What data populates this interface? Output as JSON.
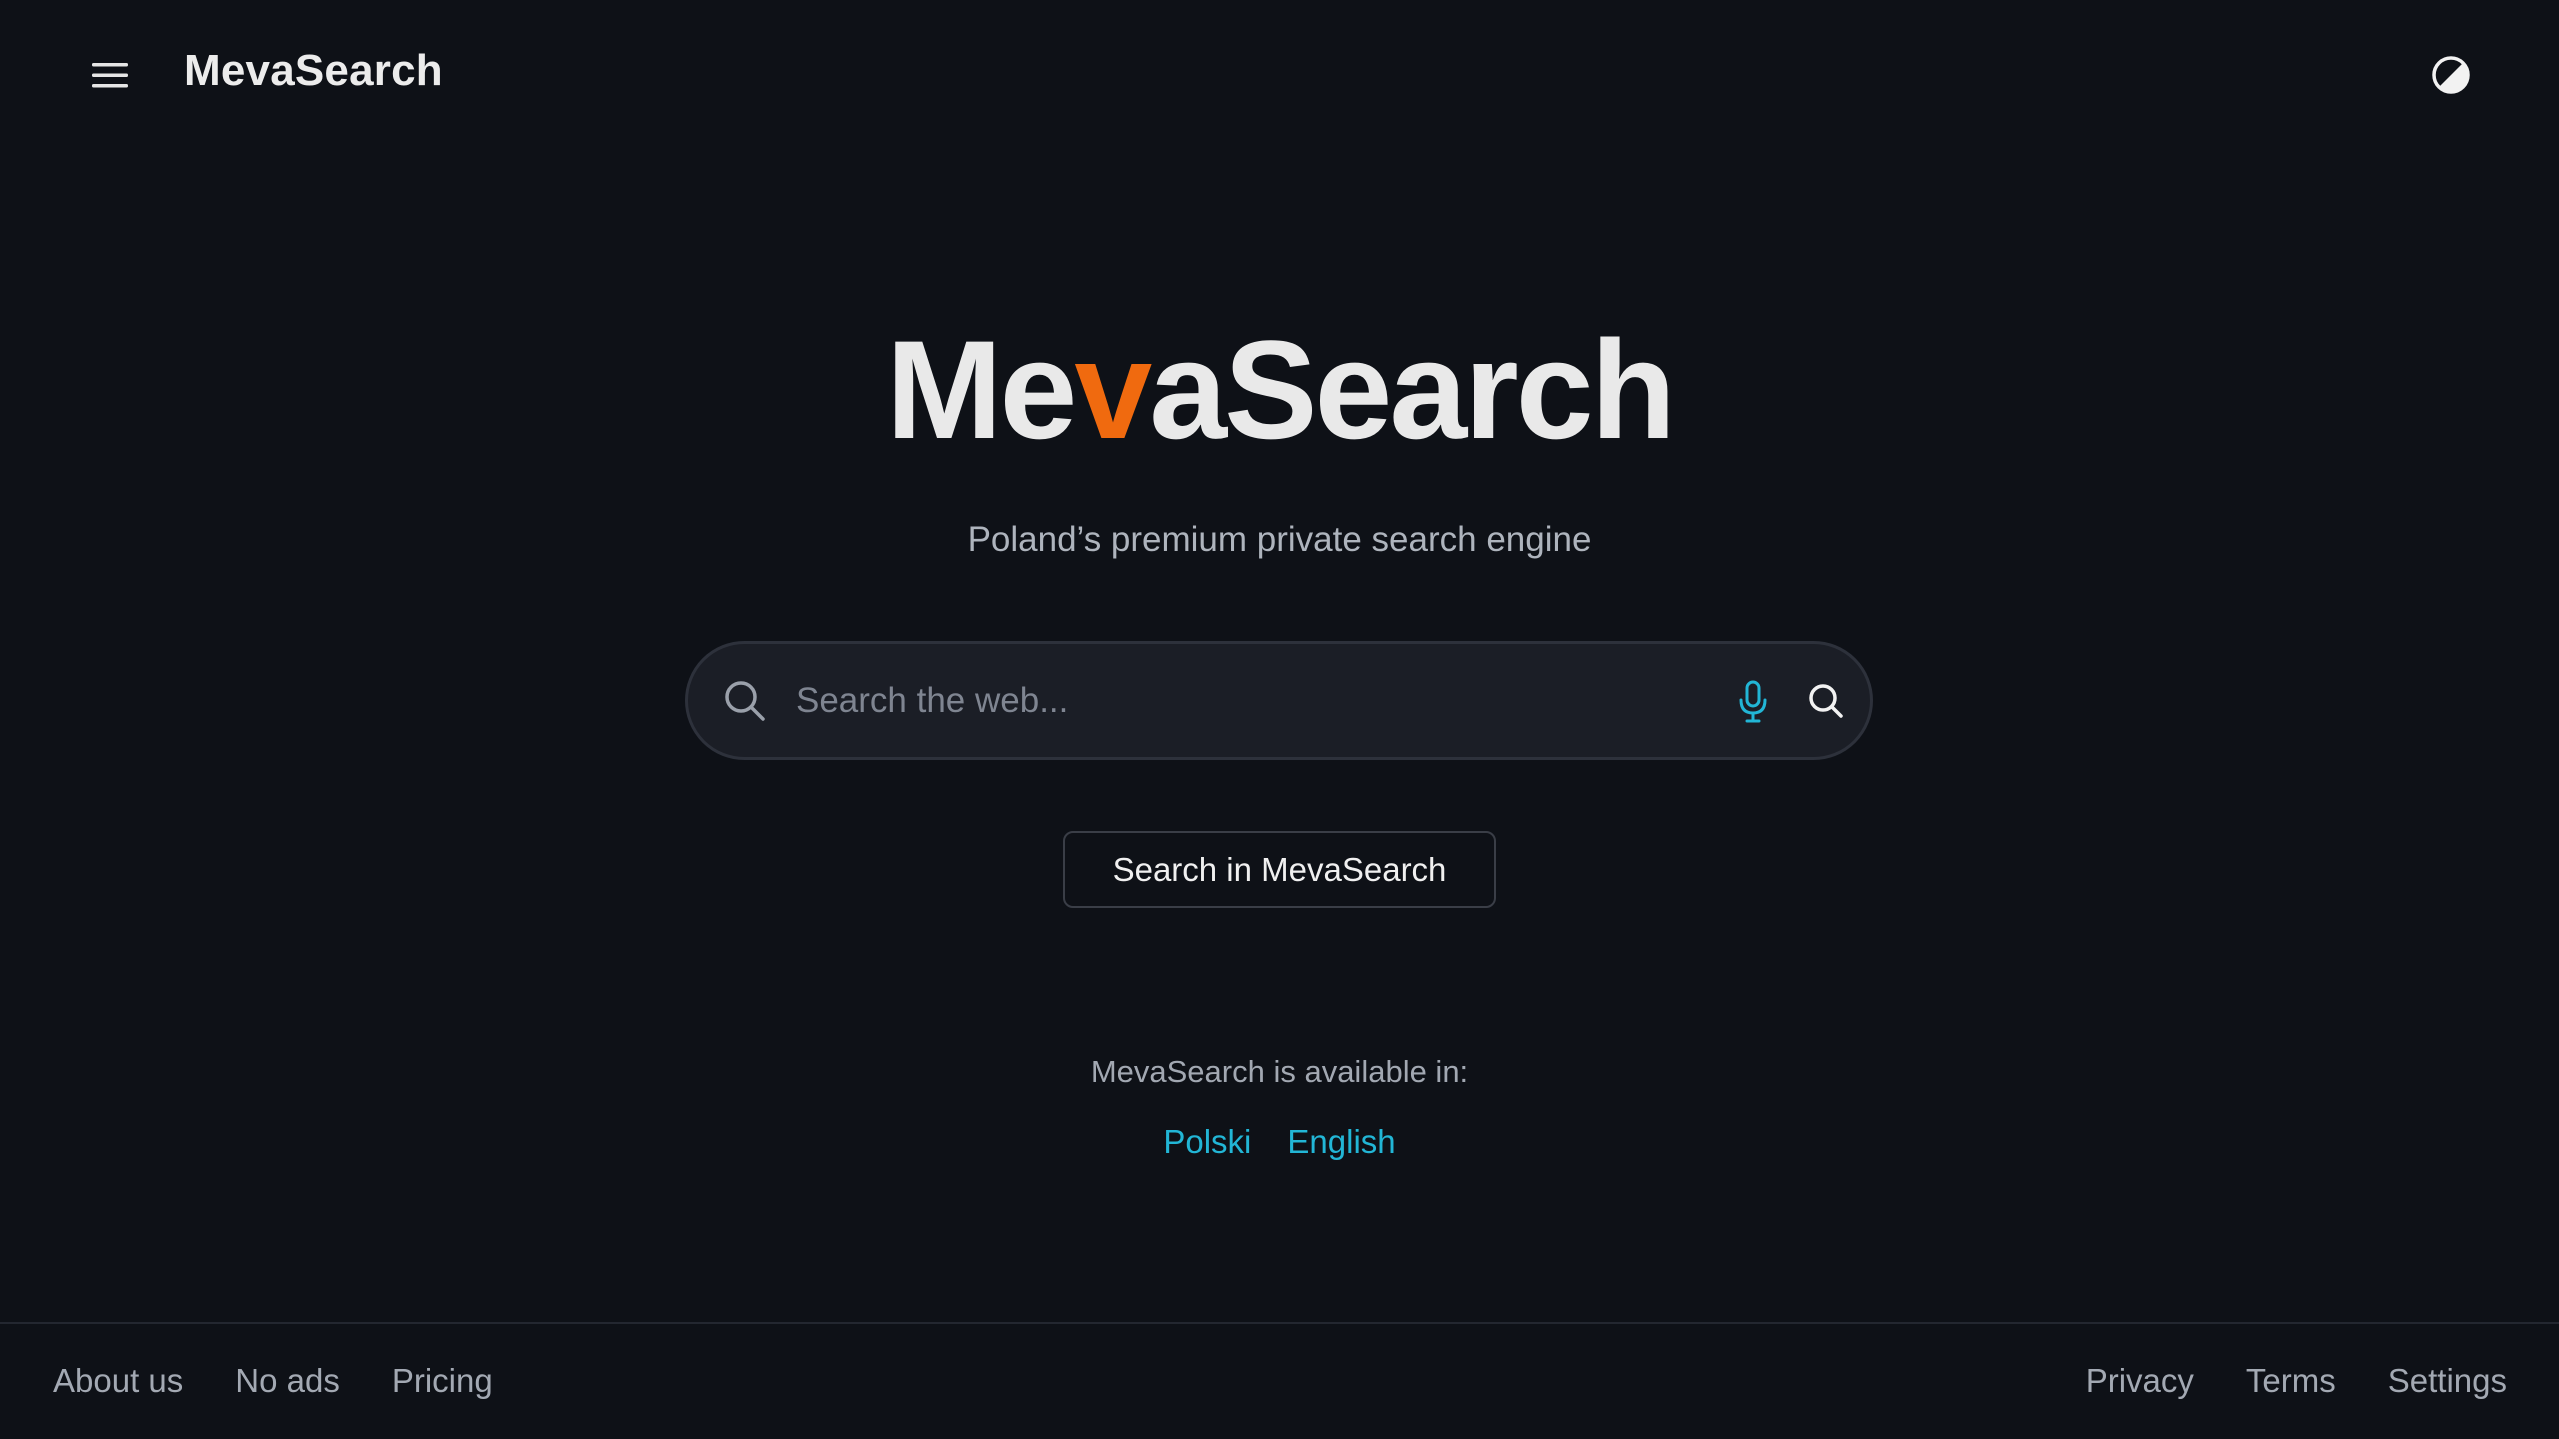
{
  "header": {
    "brand": "MevaSearch",
    "menu_icon": "hamburger-menu-icon",
    "theme_icon": "contrast-theme-icon"
  },
  "hero": {
    "logo_part1": "Me",
    "logo_accent": "v",
    "logo_part2": "aSearch",
    "tagline": "Poland’s premium private search engine"
  },
  "search": {
    "placeholder": "Search the web...",
    "value": "",
    "left_icon": "search-icon",
    "mic_icon": "microphone-icon",
    "submit_icon": "search-icon",
    "button_label": "Search in MevaSearch"
  },
  "availability": {
    "label": "MevaSearch is available in:",
    "languages": [
      "Polski",
      "English"
    ]
  },
  "footer": {
    "left_links": [
      "About us",
      "No ads",
      "Pricing"
    ],
    "right_links": [
      "Privacy",
      "Terms",
      "Settings"
    ]
  },
  "colors": {
    "background": "#0e1117",
    "accent_orange": "#f06a0f",
    "link_cyan": "#22b6d6",
    "mic_cyan": "#22b6d6"
  }
}
